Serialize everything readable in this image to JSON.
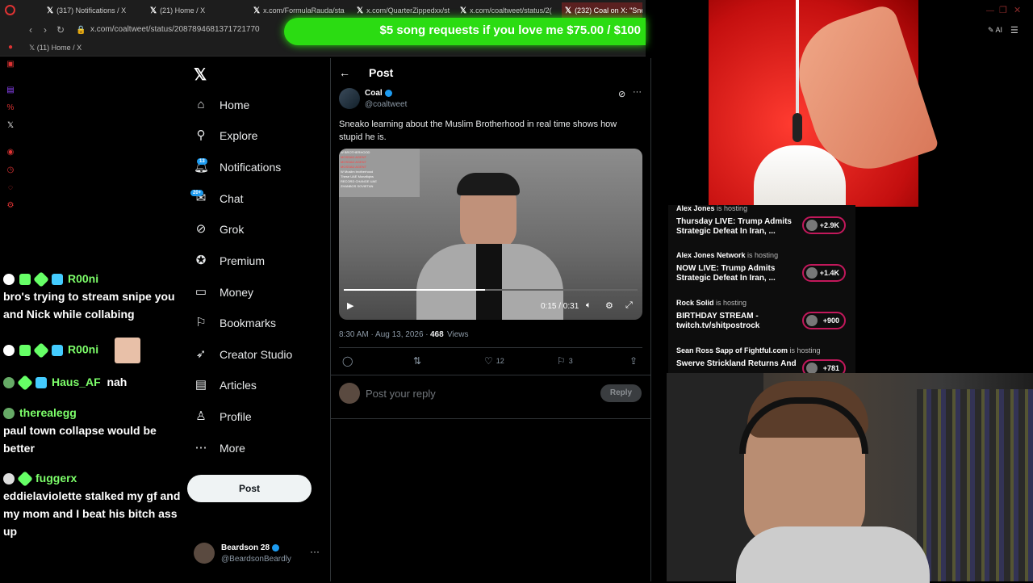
{
  "browser": {
    "tabs": [
      {
        "label": "(317) Notifications / X"
      },
      {
        "label": "(21) Home / X"
      },
      {
        "label": "x.com/FormulaRauda/sta"
      },
      {
        "label": "x.com/QuarterZippedxx/st"
      },
      {
        "label": "x.com/coaltweet/status/2("
      },
      {
        "label": "(232) Coal on X: \"Snea"
      }
    ],
    "url": "x.com/coaltweet/status/2087894681371721770",
    "bookmark": "(11) Home / X",
    "ai_label": "AI"
  },
  "banner": {
    "text": "$5 song requests if you love me $75.00 / $100"
  },
  "sidebar": {
    "items": [
      {
        "label": "Home"
      },
      {
        "label": "Explore"
      },
      {
        "label": "Notifications",
        "badge": "13"
      },
      {
        "label": "Chat",
        "badge": "20+"
      },
      {
        "label": "Grok"
      },
      {
        "label": "Premium"
      },
      {
        "label": "Money"
      },
      {
        "label": "Bookmarks"
      },
      {
        "label": "Creator Studio"
      },
      {
        "label": "Articles"
      },
      {
        "label": "Profile"
      },
      {
        "label": "More"
      }
    ],
    "post_button": "Post",
    "account": {
      "name": "Beardson 28",
      "handle": "@BeardsonBeardly"
    }
  },
  "chat": [
    {
      "user": "R00ni",
      "message": "bro's trying to stream snipe you and Nick while collabing"
    },
    {
      "user": "R00ni",
      "message": ""
    },
    {
      "user": "Haus_AF",
      "message": "nah"
    },
    {
      "user": "therealegg",
      "message": "paul town collapse would be better"
    },
    {
      "user": "fuggerx",
      "message": "eddielaviolette stalked my gf and my mom and I beat his bitch ass up"
    }
  ],
  "post": {
    "header": "Post",
    "author": "Coal",
    "handle": "@coaltweet",
    "text_line1": "Sneako learning about the Muslim Brotherhood in real time shows how",
    "text_line2": "stupid he is.",
    "video_time": "0:15 / 0:31",
    "video_progress": 0.48,
    "timestamp": "8:30 AM · Aug 13, 2026 ·",
    "views_count": "468",
    "views_label": "Views",
    "likes": "12",
    "bookmarks": "3",
    "reply_placeholder": "Post your reply",
    "reply_button": "Reply",
    "video_overlay_lines": [
      "W BROTHERHOOD",
      "MOSSAD AGENT",
      "MOSSAD AGENT",
      "MOSSAD AGENT",
      "W Muslim brotherhood",
      "These UAE Munafiqins",
      "RECORD CHANGE UAE",
      "ZHANBOS SOVIETAN"
    ]
  },
  "live_hosts": [
    {
      "host": "Alex Jones",
      "status": "is hosting",
      "title": "Thursday LIVE: Trump Admits Strategic Defeat In Iran, ...",
      "viewers": "+2.9K"
    },
    {
      "host": "Alex Jones Network",
      "status": "is hosting",
      "title": "NOW LIVE: Trump Admits Strategic Defeat In Iran, ...",
      "viewers": "+1.4K"
    },
    {
      "host": "Rock Solid",
      "status": "is hosting",
      "title": "BIRTHDAY STREAM - twitch.tv/shitpostrock",
      "viewers": "+900"
    },
    {
      "host": "Sean Ross Sapp of Fightful.com",
      "status": "is hosting",
      "title": "Swerve Strickland Returns And Lessons In The Woods",
      "viewers": "+781"
    }
  ],
  "colors": {
    "accent": "#1d9bf0",
    "banner": "#2bdc12",
    "hostBadge": "#c2185b"
  }
}
